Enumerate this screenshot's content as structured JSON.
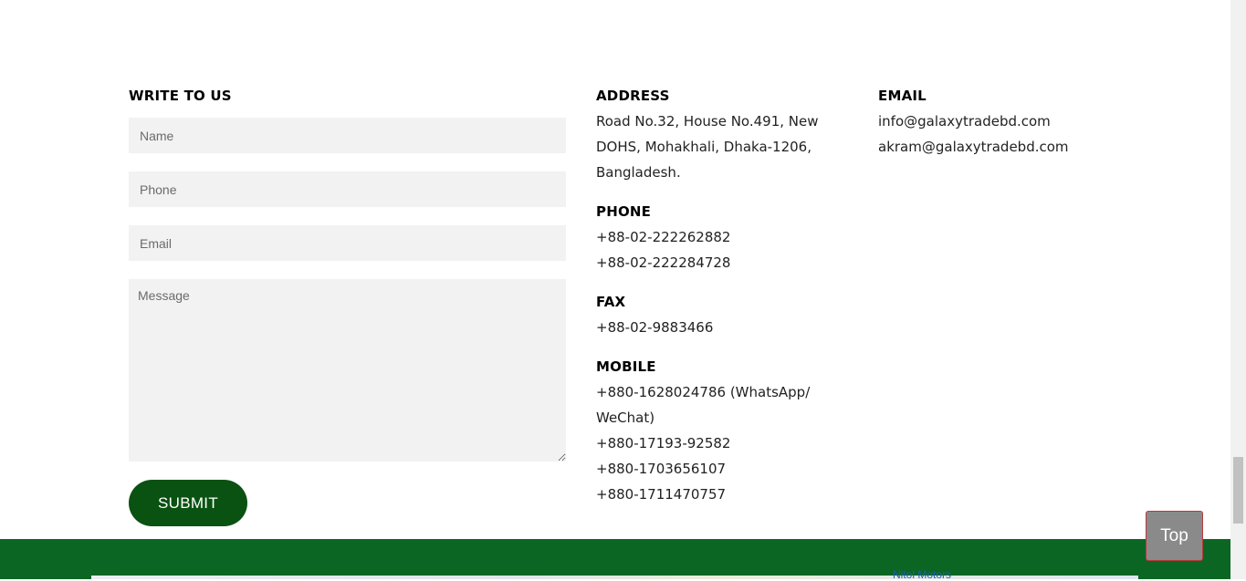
{
  "form": {
    "title": "WRITE TO US",
    "name_placeholder": "Name",
    "phone_placeholder": "Phone",
    "email_placeholder": "Email",
    "message_placeholder": "Message",
    "submit_label": "SUBMIT"
  },
  "address": {
    "title": "ADDRESS",
    "text": "Road No.32, House No.491, New DOHS, Mohakhali, Dhaka-1206, Bangladesh."
  },
  "phone": {
    "title": "PHONE",
    "numbers": [
      "+88-02-222262882",
      "+88-02-222284728"
    ]
  },
  "fax": {
    "title": "FAX",
    "numbers": [
      "+88-02-9883466"
    ]
  },
  "mobile": {
    "title": "MOBILE",
    "first": "+880-1628024786 (WhatsApp/ WeChat)",
    "numbers": [
      "+880-17193-92582",
      "+880-1703656107",
      "+880-1711470757"
    ]
  },
  "email": {
    "title": "EMAIL",
    "addresses": [
      "info@galaxytradebd.com",
      "akram@galaxytradebd.com"
    ]
  },
  "map": {
    "label": "Nitol Motors"
  },
  "top_button": {
    "label": "Top"
  },
  "colors": {
    "submit_bg": "#0a5212",
    "footer_bg": "#0c6623",
    "top_button_bg": "#8a8a8a"
  }
}
